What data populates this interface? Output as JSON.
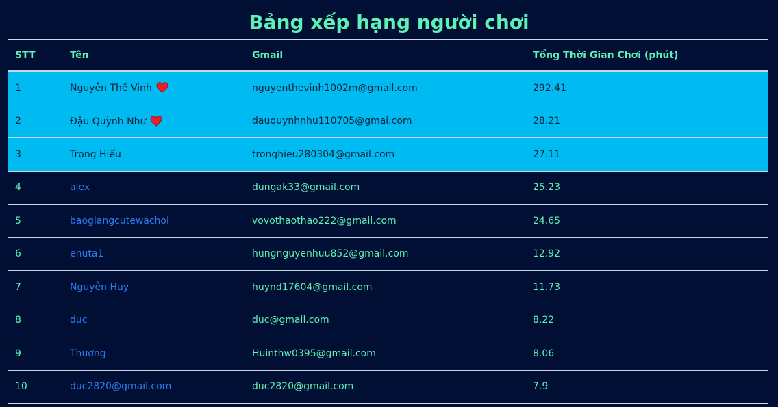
{
  "page": {
    "title": "Bảng xếp hạng người chơi"
  },
  "table": {
    "headers": [
      "STT",
      "Tên",
      "Gmail",
      "Tổng Thời Gian Chơi (phút)"
    ],
    "rows": [
      {
        "rank": "1",
        "name": "Nguyễn Thế Vinh",
        "email": "nguyenthevinh1002m@gmail.com",
        "minutes": "292.41",
        "heart": true
      },
      {
        "rank": "2",
        "name": "Đậu Quỳnh Như",
        "email": "dauquynhnhu110705@gmai.com",
        "minutes": "28.21",
        "heart": true
      },
      {
        "rank": "3",
        "name": "Trọng Hiếu",
        "email": "tronghieu280304@gmail.com",
        "minutes": "27.11",
        "heart": false
      },
      {
        "rank": "4",
        "name": "alex",
        "email": "dungak33@gmail.com",
        "minutes": "25.23",
        "heart": false
      },
      {
        "rank": "5",
        "name": "baogiangcutewachoi",
        "email": "vovothaothao222@gmail.com",
        "minutes": "24.65",
        "heart": false
      },
      {
        "rank": "6",
        "name": "enuta1",
        "email": "hungnguyenhuu852@gmail.com",
        "minutes": "12.92",
        "heart": false
      },
      {
        "rank": "7",
        "name": "Nguyễn Huy",
        "email": "huynd17604@gmail.com",
        "minutes": "11.73",
        "heart": false
      },
      {
        "rank": "8",
        "name": "duc",
        "email": "duc@gmail.com",
        "minutes": "8.22",
        "heart": false
      },
      {
        "rank": "9",
        "name": "Thương",
        "email": "Huinthw0395@gmail.com",
        "minutes": "8.06",
        "heart": false
      },
      {
        "rank": "10",
        "name": "duc2820@gmail.com",
        "email": "duc2820@gmail.com",
        "minutes": "7.9",
        "heart": false
      }
    ]
  },
  "colors": {
    "background": "#000f33",
    "accent_text": "#5ef0b4",
    "highlight_row": "#00baf2",
    "name_link": "#2e7cf2",
    "heart": "#e8202a"
  },
  "icons": {
    "heart": "heart-icon"
  }
}
